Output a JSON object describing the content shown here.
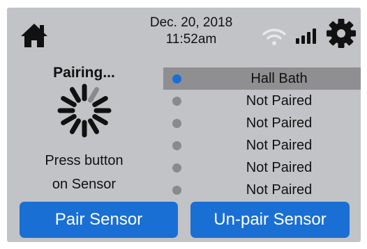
{
  "header": {
    "date": "Dec. 20, 2018",
    "time": "11:52am",
    "icons": {
      "home": "home-icon",
      "wifi": "wifi-icon",
      "signal": "signal-bars-icon",
      "settings": "gear-icon"
    }
  },
  "pairing": {
    "title": "Pairing...",
    "instruction_line1": "Press button",
    "instruction_line2": "on Sensor",
    "spinner": "spinner-icon"
  },
  "sensors": {
    "items": [
      {
        "label": "Hall Bath",
        "dot_color": "#1a6fd4",
        "selected": true
      },
      {
        "label": "Not Paired",
        "dot_color": "#8a8a8d",
        "selected": false
      },
      {
        "label": "Not Paired",
        "dot_color": "#8a8a8d",
        "selected": false
      },
      {
        "label": "Not Paired",
        "dot_color": "#8a8a8d",
        "selected": false
      },
      {
        "label": "Not Paired",
        "dot_color": "#8a8a8d",
        "selected": false
      },
      {
        "label": "Not Paired",
        "dot_color": "#8a8a8d",
        "selected": false
      }
    ]
  },
  "buttons": {
    "pair": "Pair Sensor",
    "unpair": "Un-pair Sensor"
  },
  "colors": {
    "background": "#c2c3c6",
    "button": "#1a6fd4",
    "selected_row": "#8f8f92",
    "wifi": "#e8e8e8"
  }
}
